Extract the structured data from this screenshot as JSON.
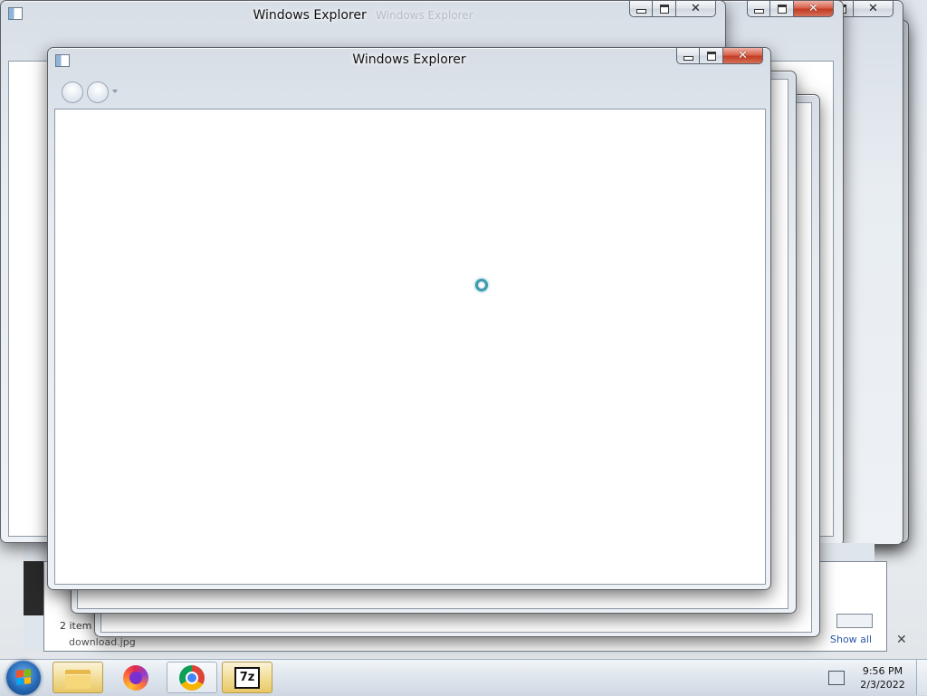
{
  "windows": {
    "back_title": "Windows Explorer",
    "back_title_ghost": "Windows Explorer",
    "front_title": "Windows Explorer"
  },
  "background_fragments": {
    "status_items": "2 item",
    "file_name": "download.jpg",
    "show_all": "Show all",
    "close_glyph": "✕"
  },
  "taskbar": {
    "pinned": [
      {
        "name": "Windows Explorer",
        "icon": "folder-icon"
      },
      {
        "name": "Firefox",
        "icon": "firefox-icon"
      },
      {
        "name": "Google Chrome",
        "icon": "chrome-icon"
      },
      {
        "name": "7-Zip",
        "icon": "7zip-icon",
        "label": "7z"
      }
    ],
    "clock_time": "9:56 PM",
    "clock_date": "2/3/2022"
  },
  "colors": {
    "close_red": "#c23c22",
    "spinner_teal": "#3a9db0",
    "taskbar_active": "#f2dc93"
  }
}
